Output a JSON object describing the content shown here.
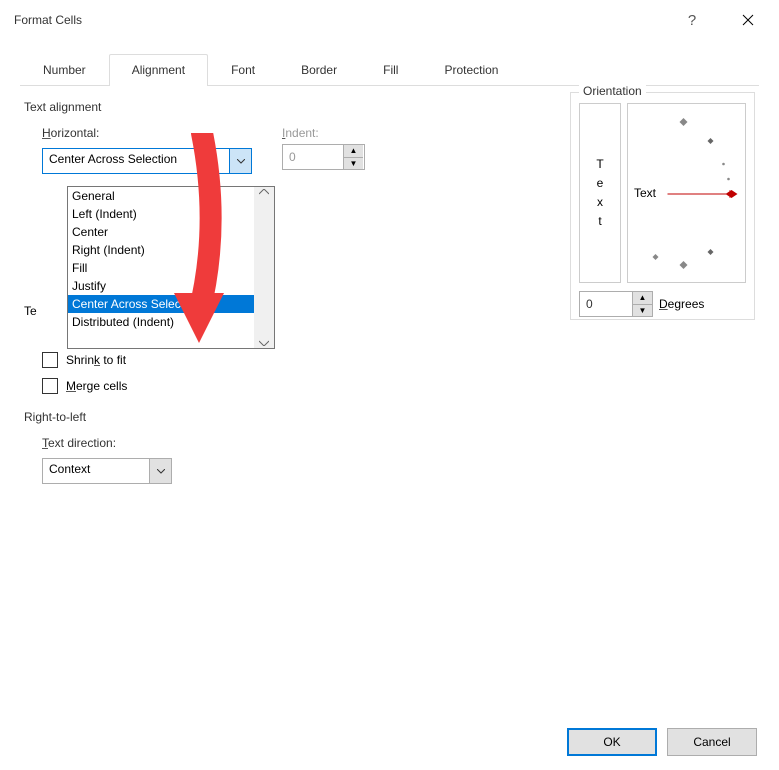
{
  "window": {
    "title": "Format Cells",
    "help_label": "?",
    "close_label": "×"
  },
  "tabs": [
    "Number",
    "Alignment",
    "Font",
    "Border",
    "Fill",
    "Protection"
  ],
  "active_tab": "Alignment",
  "alignment": {
    "section_label": "Text alignment",
    "horizontal_label": "Horizontal:",
    "horizontal_value": "Center Across Selection",
    "horizontal_options": [
      "General",
      "Left (Indent)",
      "Center",
      "Right (Indent)",
      "Fill",
      "Justify",
      "Center Across Selection",
      "Distributed (Indent)"
    ],
    "horizontal_selected_index": 6,
    "indent_label": "Indent:",
    "indent_value": "0",
    "text_control_label": "Text control",
    "shrink_label": "Shrink to fit",
    "merge_label": "Merge cells",
    "rtl_label": "Right-to-left",
    "text_direction_label": "Text direction:",
    "text_direction_value": "Context",
    "text_control_label_obscured": "Te"
  },
  "orientation": {
    "label": "Orientation",
    "vertical_text_chars": [
      "T",
      "e",
      "x",
      "t"
    ],
    "dial_label": "Text",
    "degrees_value": "0",
    "degrees_label": "Degrees"
  },
  "buttons": {
    "ok": "OK",
    "cancel": "Cancel"
  }
}
